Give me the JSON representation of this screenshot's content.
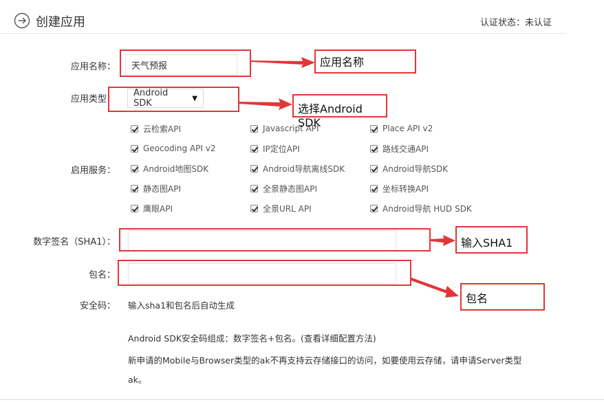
{
  "header": {
    "title": "创建应用",
    "status_label": "认证状态：",
    "status_value": "未认证"
  },
  "form": {
    "app_name_label": "应用名称：",
    "app_name_value": "天气预报",
    "app_type_label": "应用类型：",
    "app_type_value": "Android SDK",
    "services_label": "启用服务：",
    "services": [
      [
        "云检索API",
        "Javascript API",
        "Place API v2"
      ],
      [
        "Geocoding API v2",
        "IP定位API",
        "路线交通API"
      ],
      [
        "Android地图SDK",
        "Android导航离线SDK",
        "Android导航SDK"
      ],
      [
        "静态图API",
        "全景静态图API",
        "坐标转换API"
      ],
      [
        "鹰眼API",
        "全景URL API",
        "Android导航 HUD SDK"
      ]
    ],
    "sha1_label": "数字签名（SHA1）：",
    "package_label": "包名：",
    "security_label": "安全码：",
    "security_value": "输入sha1和包名后自动生成"
  },
  "info": {
    "line1": "Android SDK安全码组成：数字签名+包名。(查看详细配置方法)",
    "line2": "新申请的Mobile与Browser类型的ak不再支持云存储接口的访问，如要使用云存储，请申请Server类型",
    "line3": "ak。"
  },
  "annotations": {
    "app_name_note": "应用名称",
    "app_type_note": "选择Android SDK",
    "sha1_note": "输入SHA1",
    "package_note": "包名"
  },
  "colors": {
    "annotation_red": "#e0363a",
    "text": "#333333"
  }
}
